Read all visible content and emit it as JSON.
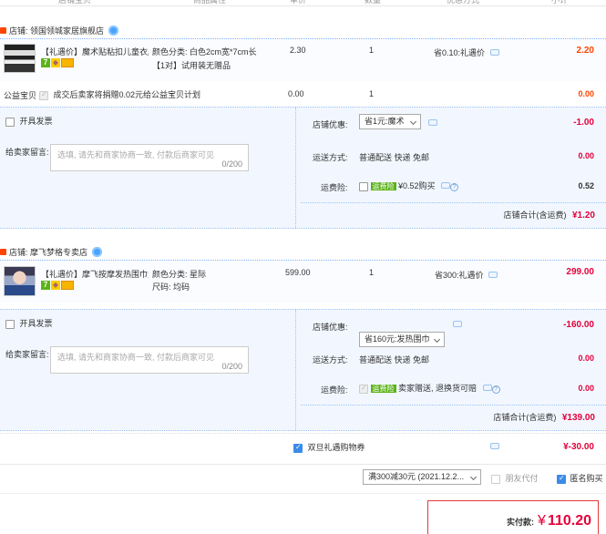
{
  "header": {
    "cols": [
      "店铺宝贝",
      "商品属性",
      "单价",
      "数量",
      "优惠方式",
      "小计"
    ]
  },
  "shop1": {
    "name": "店铺: 领国领城家居旗舰店",
    "item": {
      "title": "【礼遇价】魔术贴粘扣儿童衣服...",
      "attr1": "颜色分类: 白色2cm宽*7cm长",
      "attr2": "【1对】试用装无赠品",
      "price": "2.30",
      "qty": "1",
      "discount": "省0.10:礼遇价",
      "subtotal": "2.20"
    },
    "charity": {
      "label": "公益宝贝",
      "text": "成交后卖家将捐赠0.02元给公益宝贝计划",
      "price": "0.00",
      "qty": "1",
      "subtotal": "0.00"
    },
    "invoice_label": "开具发票",
    "message_label": "给卖家留言:",
    "message_placeholder": "选填, 请先和商家协商一致, 付款后商家可见",
    "message_count": "0/200",
    "coupon_label": "店铺优惠:",
    "coupon_value": "省1元:魔术",
    "coupon_amount": "-1.00",
    "ship_label": "运送方式:",
    "ship_value": "普通配送 快递 免邮",
    "ship_amount": "0.00",
    "insurance_label": "运费险:",
    "insurance_badge": "运费险",
    "insurance_text": "¥0.52购买",
    "insurance_amount": "0.52",
    "total_label": "店铺合计(含运费)",
    "total_value": "¥1.20"
  },
  "shop2": {
    "name": "店铺: 摩飞梦格专卖店",
    "item": {
      "title": "【礼遇价】摩飞按摩发热围巾女...",
      "attr1": "颜色分类: 星际",
      "attr2": "尺码: 均码",
      "price": "599.00",
      "qty": "1",
      "discount": "省300:礼遇价",
      "subtotal": "299.00"
    },
    "invoice_label": "开具发票",
    "message_label": "给卖家留言:",
    "message_placeholder": "选填, 请先和商家协商一致, 付款后商家可见",
    "message_count": "0/200",
    "coupon_label": "店铺优惠:",
    "coupon_value": "省160元:发热围巾",
    "coupon_amount": "-160.00",
    "ship_label": "运送方式:",
    "ship_value": "普通配送 快递 免邮",
    "ship_amount": "0.00",
    "insurance_label": "运费险:",
    "insurance_badge": "运费险",
    "insurance_text": "卖家赠送, 退换货可赔",
    "insurance_amount": "0.00",
    "total_label": "店铺合计(含运费)",
    "total_value": "¥139.00"
  },
  "platform": {
    "coupon_label": "双旦礼遇购物券",
    "coupon_value": "满300减30元 (2021.12.2...",
    "coupon_amount": "¥-30.00",
    "friend_pay": "朋友代付",
    "anonymous": "匿名购买"
  },
  "payment": {
    "label": "实付款:",
    "currency": "¥",
    "amount": "110.20"
  },
  "colors": {
    "accent_red": "#ff4400",
    "total_red": "#e4003a",
    "panel_blue": "#f2f7ff",
    "checkbox_blue": "#3b8be8",
    "badge_green": "#5bb318"
  }
}
